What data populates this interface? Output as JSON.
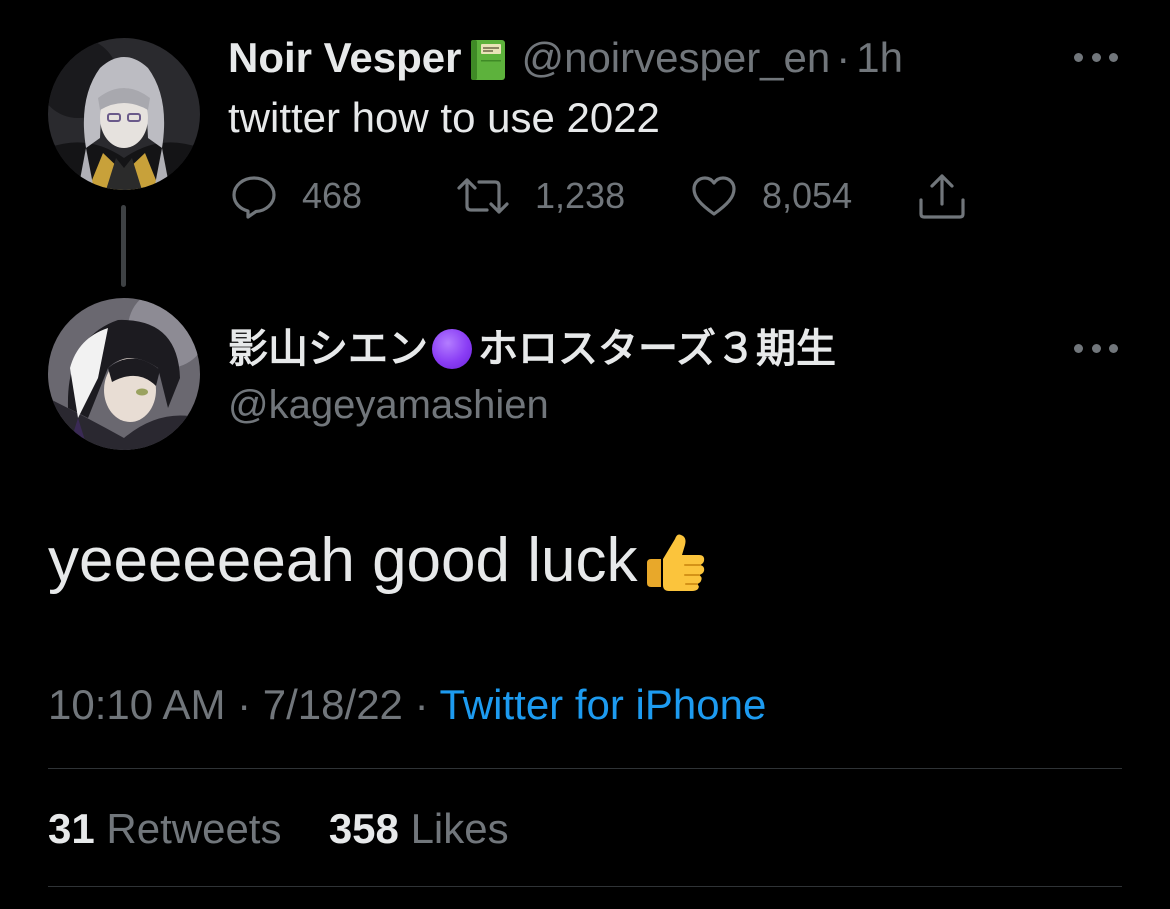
{
  "parent_tweet": {
    "display_name": "Noir Vesper",
    "name_emoji": "book-icon",
    "handle": "@noirvesper_en",
    "separator": "·",
    "time": "1h",
    "text": "twitter how to use 2022",
    "actions": {
      "reply_count": "468",
      "retweet_count": "1,238",
      "like_count": "8,054"
    }
  },
  "reply_tweet": {
    "display_name_part1": "影山シエン",
    "name_emoji": "purple-circle-icon",
    "display_name_part2": "ホロスターズ３期生",
    "handle": "@kageyamashien",
    "text": "yeeeeeeah good luck",
    "text_emoji": "thumbs-up-icon",
    "timestamp": "10:10 AM · 7/18/22 · ",
    "source": "Twitter for iPhone",
    "retweets_count": "31",
    "retweets_label": "Retweets",
    "likes_count": "358",
    "likes_label": "Likes"
  },
  "colors": {
    "background": "#000000",
    "text_primary": "#e7e9ea",
    "text_secondary": "#71767b",
    "link": "#1d9bf0",
    "divider": "#2f3336"
  }
}
